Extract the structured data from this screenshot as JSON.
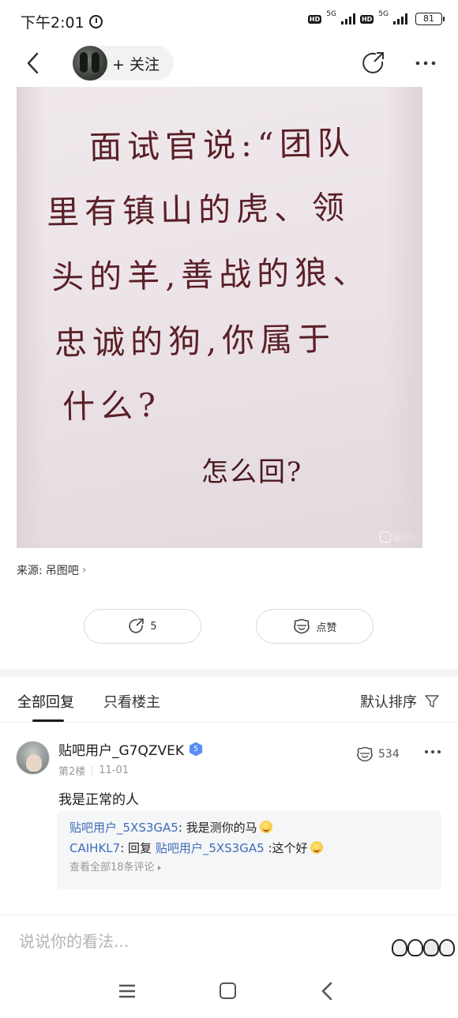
{
  "status_bar": {
    "time": "下午2:01",
    "hd_badges": [
      "HD",
      "HD"
    ],
    "network_labels": [
      "5G",
      "5G"
    ],
    "battery": "81"
  },
  "header": {
    "follow_label": "+ 关注"
  },
  "post": {
    "image_text_lines": [
      "面试官说:“团队",
      "里有镇山的虎、领",
      "头的羊,善战的狼、",
      "忠诚的狗,你属于",
      "什么?"
    ],
    "image_answer": "怎么回?",
    "watermark": "@吊图",
    "source_label": "来源:",
    "source_name": "吊图吧"
  },
  "actions": {
    "share_count": "5",
    "like_label": "点赞"
  },
  "tabs": {
    "all_replies": "全部回复",
    "op_only": "只看楼主",
    "sort_label": "默认排序"
  },
  "comment": {
    "username": "贴吧用户_G7QZVEK",
    "level": "5",
    "floor": "第2楼",
    "date": "11-01",
    "likes": "534",
    "text": "我是正常的人",
    "replies": [
      {
        "user": "贴吧用户_5XS3GA5",
        "separator": ":",
        "text": "我是测你的马"
      },
      {
        "user": "CAIHKL7",
        "separator": ":",
        "prefix": "回复",
        "target_user": "贴吧用户_5XS3GA5",
        "text": ":这个好"
      }
    ],
    "view_all": "查看全部18条评论"
  },
  "input": {
    "placeholder": "说说你的看法..."
  },
  "icons": {
    "back": "chevron-left-icon",
    "share": "share-arrow-icon",
    "more": "more-dots-icon",
    "like": "like-face-icon",
    "filter": "funnel-icon"
  }
}
